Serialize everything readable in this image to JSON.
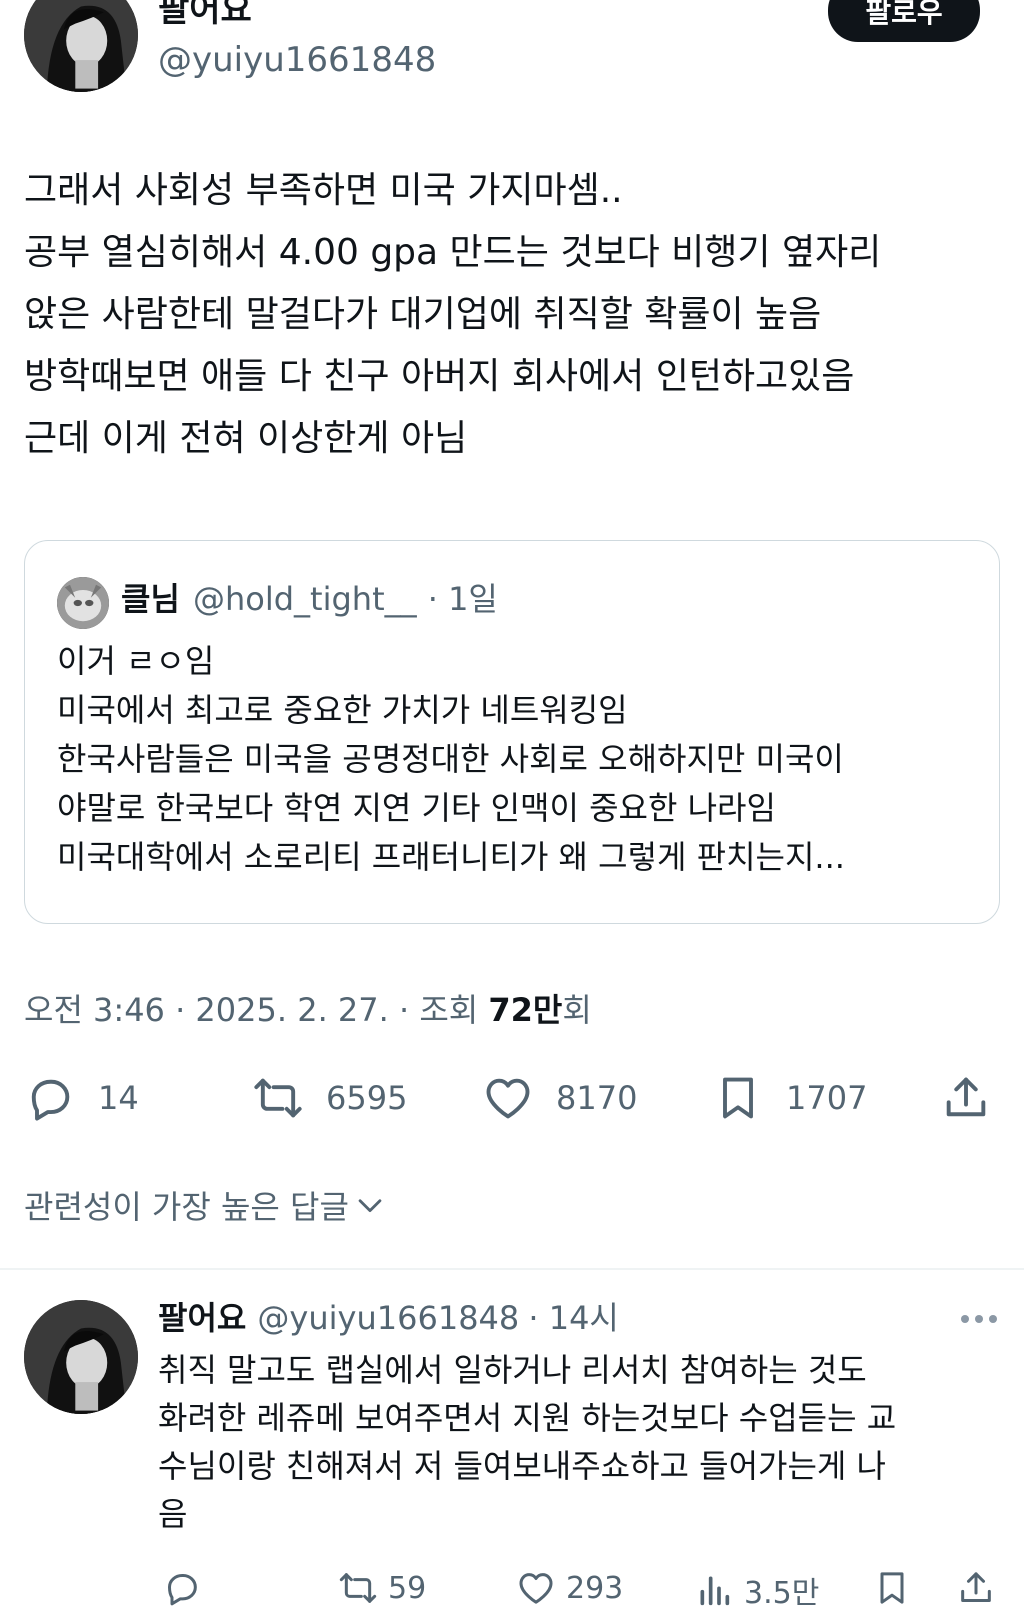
{
  "tweet": {
    "author_name": "팔어요",
    "author_handle": "@yuiyu1661848",
    "follow_label": "팔로우",
    "lines": [
      "그래서 사회성 부족하면 미국 가지마셈..",
      "공부 열심히해서 4.00 gpa 만드는 것보다 비행기 옆자리",
      "앉은 사람한테 말걸다가 대기업에 취직할 확률이 높음",
      "방학때보면 애들 다 친구 아버지 회사에서 인턴하고있음",
      "근데 이게 전혀 이상한게 아님"
    ]
  },
  "quote": {
    "author_name": "클님",
    "author_handle": "@hold_tight__",
    "time": "· 1일",
    "lines": [
      "이거 ㄹㅇ임",
      "미국에서 최고로 중요한 가치가 네트워킹임",
      "한국사람들은 미국을 공명정대한 사회로 오해하지만 미국이",
      "야말로 한국보다 학연 지연 기타 인맥이 중요한 나라임",
      "미국대학에서 소로리티 프래터니티가 왜 그렇게 판치는지..."
    ]
  },
  "meta": {
    "time_date": "오전 3:46 · 2025. 2. 27. · 조회 ",
    "views": "72만",
    "views_suffix": "회"
  },
  "actions": {
    "replies": "14",
    "retweets": "6595",
    "likes": "8170",
    "bookmarks": "1707"
  },
  "sort_label": "관련성이 가장 높은 답글",
  "reply": {
    "author_name": "팔어요",
    "author_handle": "@yuiyu1661848",
    "time": "· 14시",
    "lines": [
      "취직 말고도 랩실에서 일하거나 리서치 참여하는 것도",
      "화려한 레쥬메 보여주면서 지원 하는것보다 수업듣는 교",
      "수님이랑 친해져서 저 들여보내주쇼하고 들어가는게 나",
      "음"
    ],
    "actions": {
      "retweets": "59",
      "likes": "293",
      "views": "3.5만"
    }
  },
  "icons": [
    "reply-icon",
    "retweet-icon",
    "heart-icon",
    "bookmark-icon",
    "share-icon",
    "views-icon",
    "more-icon",
    "chevron-down-icon"
  ]
}
